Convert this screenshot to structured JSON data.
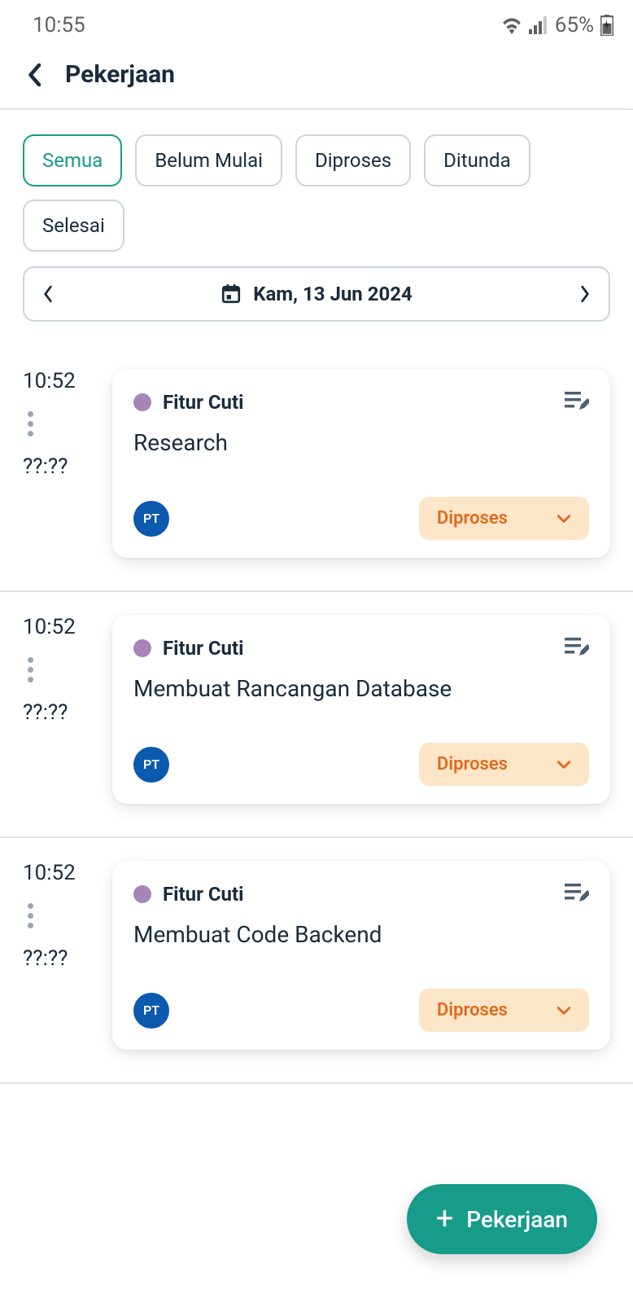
{
  "status_bar": {
    "time": "10:55",
    "battery": "65%"
  },
  "header": {
    "title": "Pekerjaan"
  },
  "tabs": [
    {
      "label": "Semua",
      "active": true
    },
    {
      "label": "Belum Mulai",
      "active": false
    },
    {
      "label": "Diproses",
      "active": false
    },
    {
      "label": "Ditunda",
      "active": false
    },
    {
      "label": "Selesai",
      "active": false
    }
  ],
  "date_picker": {
    "label": "Kam, 13 Jun 2024"
  },
  "tasks": [
    {
      "start_time": "10:52",
      "end_time": "??:??",
      "tag": "Fitur Cuti",
      "title": "Research",
      "avatar": "PT",
      "status": "Diproses"
    },
    {
      "start_time": "10:52",
      "end_time": "??:??",
      "tag": "Fitur Cuti",
      "title": "Membuat Rancangan Database",
      "avatar": "PT",
      "status": "Diproses"
    },
    {
      "start_time": "10:52",
      "end_time": "??:??",
      "tag": "Fitur Cuti",
      "title": "Membuat Code Backend",
      "avatar": "PT",
      "status": "Diproses"
    }
  ],
  "fab": {
    "label": "Pekerjaan"
  }
}
